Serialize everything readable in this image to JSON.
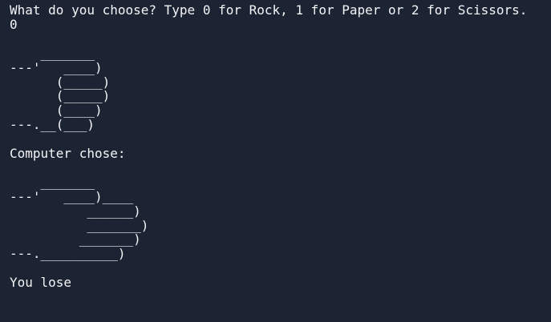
{
  "terminal": {
    "prompt": "What do you choose? Type 0 for Rock, 1 for Paper or 2 for Scissors.",
    "user_input": "0",
    "user_art": "    _______\n---'   ____)\n      (_____)\n      (_____)\n      (____)\n---.__(___)",
    "computer_label": "Computer chose:",
    "computer_art": "    _______\n---'   ____)____\n          ______)\n          _______)\n         _______)\n---.__________)",
    "result": "You lose"
  }
}
